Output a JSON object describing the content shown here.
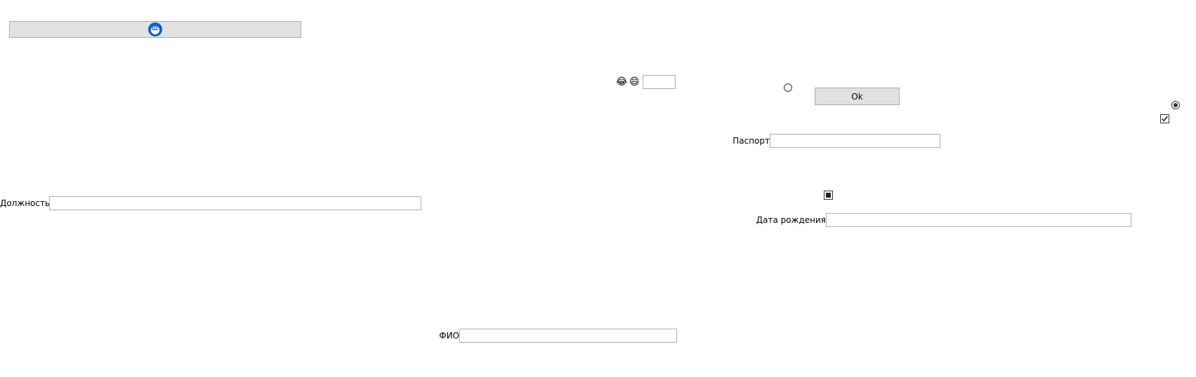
{
  "top_button": {
    "icon": "circular-logo-icon",
    "accent": "#0a66c2"
  },
  "emoji_pair": {
    "first": "😂",
    "second": "😄"
  },
  "small_input": {
    "value": ""
  },
  "ok_button": {
    "label": "Ok"
  },
  "radio_left": {
    "checked": false
  },
  "radio_right": {
    "checked": true
  },
  "checkbox_checked": {
    "checked": true
  },
  "checkbox_indeterminate": {
    "state": "indeterminate"
  },
  "passport": {
    "label": "Паспорт",
    "value": ""
  },
  "position": {
    "label": "Должность",
    "value": ""
  },
  "birth_date": {
    "label": "Дата рождения",
    "value": ""
  },
  "full_name": {
    "label": "ФИО",
    "value": ""
  }
}
